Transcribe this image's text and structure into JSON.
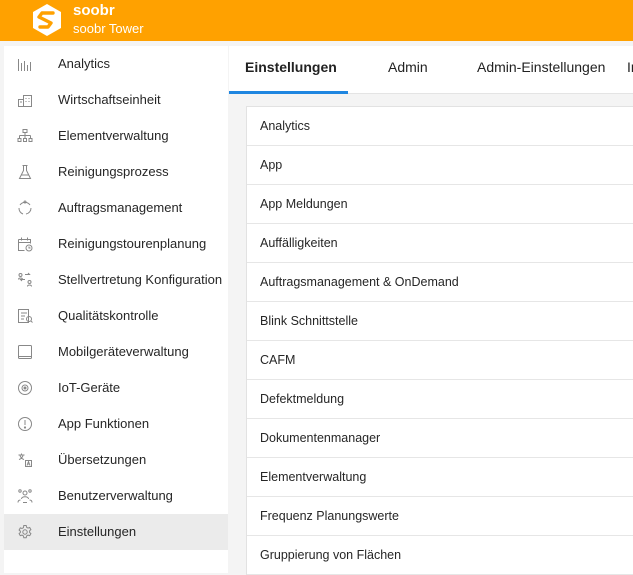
{
  "header": {
    "brand_name": "soobr",
    "brand_sub": "soobr Tower",
    "accent_color": "#ffa100",
    "logo_icon": "soobr-logo"
  },
  "sidebar": {
    "items": [
      {
        "label": "Analytics",
        "icon": "bar-chart-icon"
      },
      {
        "label": "Wirtschaftseinheit",
        "icon": "building-icon"
      },
      {
        "label": "Elementverwaltung",
        "icon": "hierarchy-icon"
      },
      {
        "label": "Reinigungsprozess",
        "icon": "flask-icon"
      },
      {
        "label": "Auftragsmanagement",
        "icon": "cycle-icon"
      },
      {
        "label": "Reinigungstourenplanung",
        "icon": "calendar-clock-icon"
      },
      {
        "label": "Stellvertretung Konfiguration",
        "icon": "swap-icon"
      },
      {
        "label": "Qualitätskontrolle",
        "icon": "checklist-icon"
      },
      {
        "label": "Mobilgeräteverwaltung",
        "icon": "tablet-icon"
      },
      {
        "label": "IoT-Geräte",
        "icon": "sensor-icon"
      },
      {
        "label": "App Funktionen",
        "icon": "info-icon"
      },
      {
        "label": "Übersetzungen",
        "icon": "translate-icon"
      },
      {
        "label": "Benutzerverwaltung",
        "icon": "users-icon"
      },
      {
        "label": "Einstellungen",
        "icon": "gear-icon",
        "active": true
      }
    ]
  },
  "tabs": [
    {
      "label": "Einstellungen",
      "active": true
    },
    {
      "label": "Admin"
    },
    {
      "label": "Admin-Einstellungen"
    },
    {
      "label": "In"
    }
  ],
  "tab_indicator_color": "#1f86e0",
  "settings_list": [
    "Analytics",
    "App",
    "App Meldungen",
    "Auffälligkeiten",
    "Auftragsmanagement & OnDemand",
    "Blink Schnittstelle",
    "CAFM",
    "Defektmeldung",
    "Dokumentenmanager",
    "Elementverwaltung",
    "Frequenz Planungswerte",
    "Gruppierung von Flächen"
  ]
}
